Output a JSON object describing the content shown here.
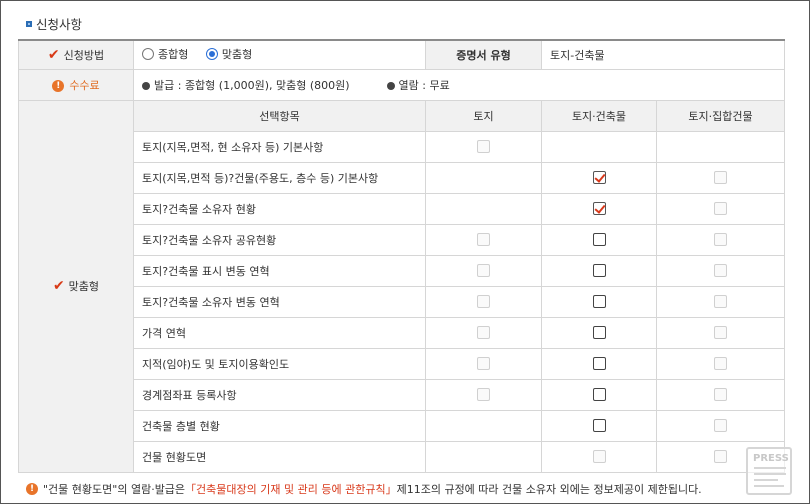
{
  "section": {
    "title": "신청사항"
  },
  "row_method": {
    "label": "신청방법",
    "options": [
      {
        "label": "종합형",
        "selected": false
      },
      {
        "label": "맞춤형",
        "selected": true
      }
    ],
    "cert_type_label": "증명서 유형",
    "cert_type_value": "토지-건축물"
  },
  "row_fee": {
    "label": "수수료",
    "issue_text": "발급 : 종합형 (1,000원), 맞춤형 (800원)",
    "view_text": "열람 : 무료"
  },
  "custom": {
    "label": "맞춤형",
    "headers": {
      "item": "선택항목",
      "land": "토지",
      "land_building": "토지·건축물",
      "land_collective": "토지·집합건물"
    },
    "rows": [
      {
        "label": "토지(지목,면적, 현 소유자 등) 기본사항",
        "land": "disabled",
        "land_building": "none",
        "land_collective": "none"
      },
      {
        "label": "토지(지목,면적 등)?건물(주용도, 층수 등) 기본사항",
        "land": "none",
        "land_building": "checked",
        "land_collective": "disabled"
      },
      {
        "label": "토지?건축물 소유자 현황",
        "land": "none",
        "land_building": "checked",
        "land_collective": "disabled"
      },
      {
        "label": "토지?건축물 소유자 공유현황",
        "land": "disabled",
        "land_building": "unchecked",
        "land_collective": "disabled"
      },
      {
        "label": "토지?건축물 표시 변동 연혁",
        "land": "disabled",
        "land_building": "unchecked",
        "land_collective": "disabled"
      },
      {
        "label": "토지?건축물 소유자 변동 연혁",
        "land": "disabled",
        "land_building": "unchecked",
        "land_collective": "disabled"
      },
      {
        "label": "가격 연혁",
        "land": "disabled",
        "land_building": "unchecked",
        "land_collective": "disabled"
      },
      {
        "label": "지적(임야)도 및 토지이용확인도",
        "land": "disabled",
        "land_building": "unchecked",
        "land_collective": "disabled"
      },
      {
        "label": "경계점좌표 등록사항",
        "land": "disabled",
        "land_building": "unchecked",
        "land_collective": "disabled"
      },
      {
        "label": "건축물 층별 현황",
        "land": "none",
        "land_building": "unchecked",
        "land_collective": "disabled"
      },
      {
        "label": "건물 현황도면",
        "land": "none",
        "land_building": "disabled",
        "land_collective": "disabled"
      }
    ]
  },
  "footer": {
    "part1": "\"건물 현황도면\"의 열람·발급은 ",
    "part2": "「건축물대장의 기재 및 관리 등에 관한규칙」",
    "part3": " 제11조의 규정에 따라 건물 소유자 외에는 정보제공이 제한됩니다."
  },
  "watermark": {
    "text": "PRESS"
  }
}
